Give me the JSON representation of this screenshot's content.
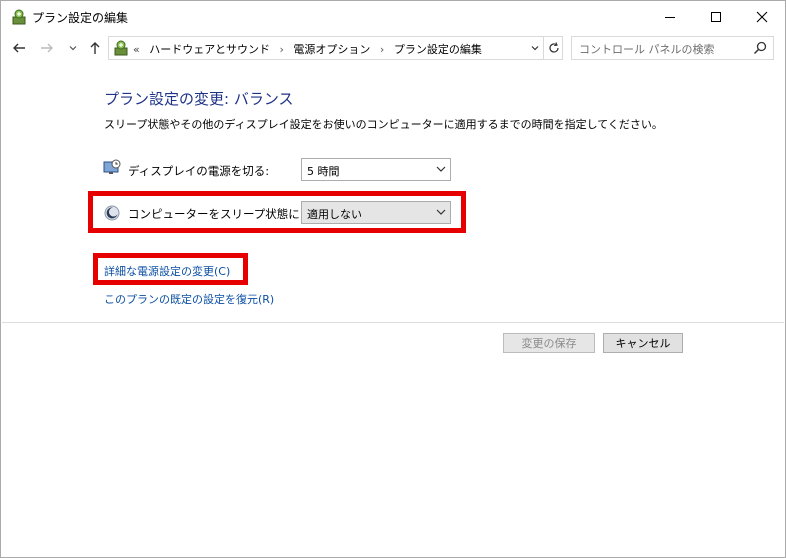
{
  "window": {
    "title": "プラン設定の編集"
  },
  "nav": {
    "address": {
      "overflow": "«",
      "crumbs": [
        "ハードウェアとサウンド",
        "電源オプション",
        "プラン設定の編集"
      ],
      "separator": "›"
    },
    "search": {
      "placeholder": "コントロール パネルの検索"
    }
  },
  "main": {
    "heading": "プラン設定の変更: バランス",
    "description": "スリープ状態やその他のディスプレイ設定をお使いのコンピューターに適用するまでの時間を指定してください。",
    "display_off": {
      "label": "ディスプレイの電源を切る:",
      "value": "5 時間",
      "icon": "monitor-clock-icon"
    },
    "sleep": {
      "label": "コンピューターをスリープ状態にする:",
      "value": "適用しない",
      "icon": "moon-icon"
    },
    "links": {
      "advanced": "詳細な電源設定の変更(C)",
      "restore": "このプランの既定の設定を復元(R)"
    }
  },
  "buttons": {
    "save": "変更の保存",
    "cancel": "キャンセル"
  },
  "colors": {
    "heading": "#1e3287",
    "link": "#0b4fa3",
    "highlight": "#e60000"
  }
}
